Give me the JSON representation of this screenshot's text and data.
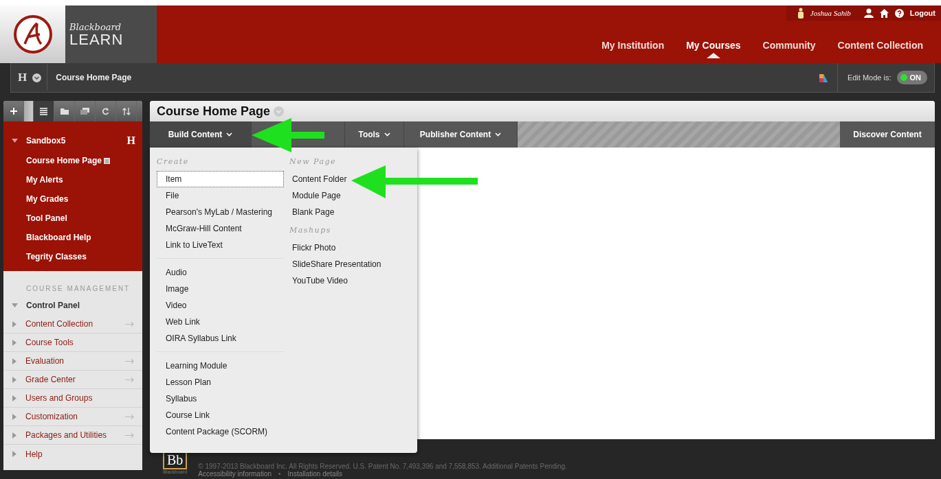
{
  "header": {
    "logo": {
      "line1": "Blackboard",
      "line2": "LEARN"
    },
    "user": {
      "name": "Joshua Sahib",
      "logout": "Logout"
    },
    "nav": [
      {
        "label": "My Institution",
        "selected": false
      },
      {
        "label": "My Courses",
        "selected": true
      },
      {
        "label": "Community",
        "selected": false
      },
      {
        "label": "Content Collection",
        "selected": false
      }
    ]
  },
  "breadcrumb": {
    "initial": "H",
    "label": "Course Home Page",
    "edit_mode": {
      "label": "Edit Mode is:",
      "state": "ON",
      "on": true
    }
  },
  "sidebar": {
    "tools": [
      {
        "kind": "add",
        "selected": false
      },
      {
        "kind": "spacer",
        "selected": false
      },
      {
        "kind": "list",
        "selected": true
      },
      {
        "kind": "folder",
        "selected": false
      },
      {
        "kind": "window",
        "selected": false
      },
      {
        "kind": "refresh",
        "selected": false
      },
      {
        "kind": "sort",
        "selected": false
      }
    ],
    "course": {
      "name": "Sandbox5",
      "initial": "H",
      "expanded": true,
      "items": [
        {
          "label": "Course Home Page",
          "has_page_icon": true
        },
        {
          "label": "My Alerts",
          "has_page_icon": false
        },
        {
          "label": "My Grades",
          "has_page_icon": false
        },
        {
          "label": "Tool Panel",
          "has_page_icon": false
        },
        {
          "label": "Blackboard Help",
          "has_page_icon": false
        },
        {
          "label": "Tegrity Classes",
          "has_page_icon": false
        }
      ]
    },
    "management": {
      "heading": "COURSE MANAGEMENT",
      "panel": "Control Panel",
      "expanded": true,
      "items": [
        {
          "label": "Content Collection",
          "has_arrow": true
        },
        {
          "label": "Course Tools",
          "has_arrow": false
        },
        {
          "label": "Evaluation",
          "has_arrow": true
        },
        {
          "label": "Grade Center",
          "has_arrow": true
        },
        {
          "label": "Users and Groups",
          "has_arrow": false
        },
        {
          "label": "Customization",
          "has_arrow": true
        },
        {
          "label": "Packages and Utilities",
          "has_arrow": true
        },
        {
          "label": "Help",
          "has_arrow": false
        }
      ]
    }
  },
  "content": {
    "title": "Course Home Page",
    "toolbar": [
      {
        "label": "Build Content",
        "selected": true
      },
      {
        "selected": false
      },
      {
        "label": "Tools",
        "selected": false
      },
      {
        "label": "Publisher Content",
        "selected": false
      }
    ],
    "discover": "Discover Content",
    "menu": {
      "create": {
        "heading": "Create",
        "groups": [
          [
            {
              "label": "Item",
              "selected": true
            },
            {
              "label": "File",
              "selected": false
            },
            {
              "label": "Pearson's MyLab / Mastering",
              "selected": false
            },
            {
              "label": "McGraw-Hill Content",
              "selected": false
            },
            {
              "label": "Link to LiveText",
              "selected": false
            }
          ],
          [
            {
              "label": "Audio",
              "selected": false
            },
            {
              "label": "Image",
              "selected": false
            },
            {
              "label": "Video",
              "selected": false
            },
            {
              "label": "Web Link",
              "selected": false
            },
            {
              "label": "OIRA Syllabus Link",
              "selected": false
            }
          ],
          [
            {
              "label": "Learning Module",
              "selected": false
            },
            {
              "label": "Lesson Plan",
              "selected": false
            },
            {
              "label": "Syllabus",
              "selected": false
            },
            {
              "label": "Course Link",
              "selected": false
            },
            {
              "label": "Content Package (SCORM)",
              "selected": false
            }
          ]
        ]
      },
      "sections": [
        {
          "heading": "New Page",
          "items": [
            {
              "label": "Content Folder",
              "selected": false
            },
            {
              "label": "Module Page",
              "selected": false
            },
            {
              "label": "Blank Page",
              "selected": false
            }
          ]
        },
        {
          "heading": "Mashups",
          "items": [
            {
              "label": "Flickr Photo",
              "selected": false
            },
            {
              "label": "SlideShare Presentation",
              "selected": false
            },
            {
              "label": "YouTube Video",
              "selected": false
            }
          ]
        }
      ]
    }
  },
  "footer": {
    "logo": "Bb",
    "logo_caption": "Blackboard",
    "copyright": "© 1997-2013 Blackboard Inc. All Rights Reserved. U.S. Patent No. 7,493,396 and 7,558,853. Additional Patents Pending.",
    "links": [
      "Accessibility information",
      "Installation details"
    ],
    "separator": "•"
  }
}
